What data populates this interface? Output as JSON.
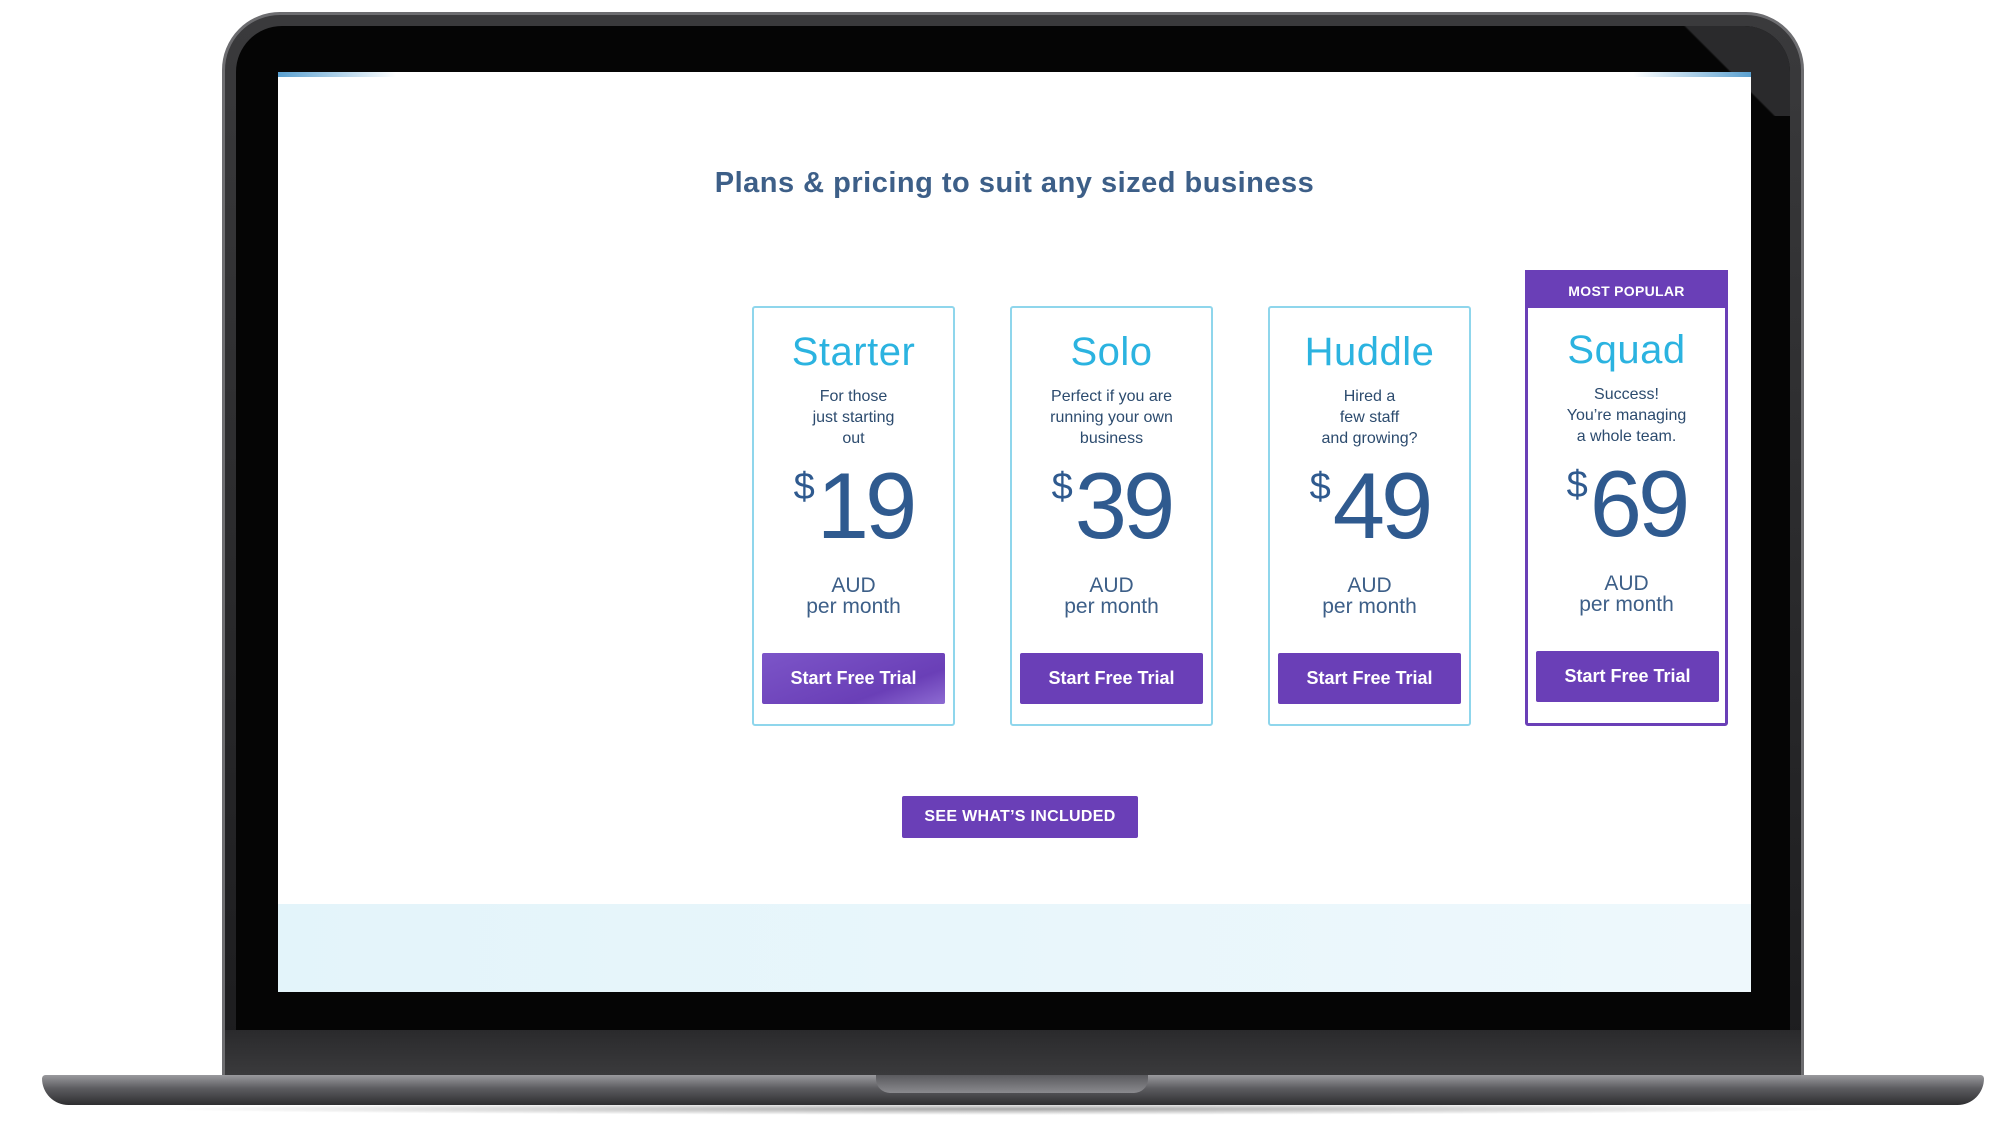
{
  "page": {
    "headline": "Plans & pricing to suit any sized business",
    "see_included_label": "SEE WHAT’S INCLUDED"
  },
  "plans": [
    {
      "name": "Starter",
      "description": [
        "For those",
        "just starting",
        "out"
      ],
      "currency_symbol": "$",
      "price": "19",
      "currency": "AUD",
      "period": "per month",
      "button_label": "Start Free Trial"
    },
    {
      "name": "Solo",
      "description": [
        "Perfect if you are",
        "running your own",
        "business"
      ],
      "currency_symbol": "$",
      "price": "39",
      "currency": "AUD",
      "period": "per month",
      "button_label": "Start Free Trial"
    },
    {
      "name": "Huddle",
      "description": [
        "Hired a",
        "few staff",
        "and growing?"
      ],
      "currency_symbol": "$",
      "price": "49",
      "currency": "AUD",
      "period": "per month",
      "button_label": "Start Free Trial"
    },
    {
      "name": "Squad",
      "badge": "MOST POPULAR",
      "description": [
        "Success!",
        "You’re managing",
        "a whole team."
      ],
      "currency_symbol": "$",
      "price": "69",
      "currency": "AUD",
      "period": "per month",
      "button_label": "Start Free Trial"
    }
  ],
  "colors": {
    "accent_purple": "#6a3fb7",
    "plan_name_cyan": "#2bb3e0",
    "price_blue": "#2f5a8f",
    "card_border": "#8fd6ec"
  }
}
